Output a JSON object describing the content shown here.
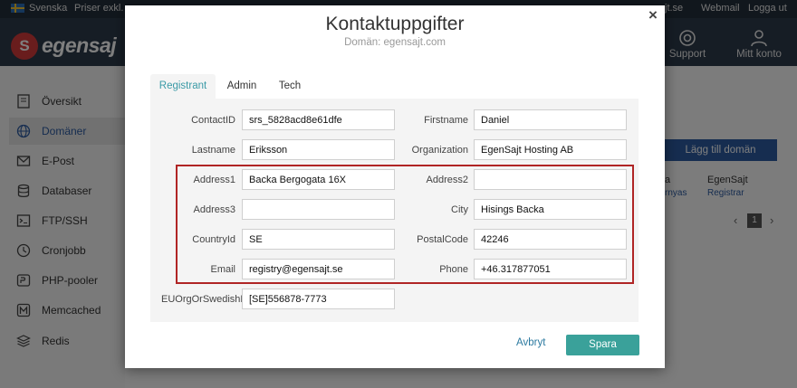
{
  "topbar": {
    "language": "Svenska",
    "prices": "Priser exkl. m",
    "site_link": "jt.se",
    "webmail": "Webmail",
    "logout": "Logga ut"
  },
  "header": {
    "logo_mark": "S",
    "logo_text": "egensaj",
    "support": "Support",
    "account": "Mitt konto"
  },
  "sidebar": {
    "items": [
      {
        "label": "Översikt",
        "icon": "overview-icon"
      },
      {
        "label": "Domäner",
        "icon": "globe-icon"
      },
      {
        "label": "E-Post",
        "icon": "email-icon"
      },
      {
        "label": "Databaser",
        "icon": "database-icon"
      },
      {
        "label": "FTP/SSH",
        "icon": "terminal-icon"
      },
      {
        "label": "Cronjobb",
        "icon": "clock-icon"
      },
      {
        "label": "PHP-pooler",
        "icon": "php-icon"
      },
      {
        "label": "Memcached",
        "icon": "memcached-icon"
      },
      {
        "label": "Redis",
        "icon": "redis-icon"
      }
    ]
  },
  "main": {
    "add_domain": "Lägg till domän",
    "col_a": "a",
    "col_a_sub": "rnyas",
    "col_b": "EgenSajt",
    "col_b_sub": "Registrar",
    "page_number": "1"
  },
  "modal": {
    "title": "Kontaktuppgifter",
    "subtitle": "Domän: egensajt.com",
    "close": "×",
    "tabs": [
      "Registrant",
      "Admin",
      "Tech"
    ],
    "fields": {
      "contact_id": {
        "label": "ContactID",
        "value": "srs_5828acd8e61dfe"
      },
      "firstname": {
        "label": "Firstname",
        "value": "Daniel"
      },
      "lastname": {
        "label": "Lastname",
        "value": "Eriksson"
      },
      "organization": {
        "label": "Organization",
        "value": "EgenSajt Hosting AB"
      },
      "address1": {
        "label": "Address1",
        "value": "Backa Bergogata 16X"
      },
      "address2": {
        "label": "Address2",
        "value": ""
      },
      "address3": {
        "label": "Address3",
        "value": ""
      },
      "city": {
        "label": "City",
        "value": "Hisings Backa"
      },
      "country_id": {
        "label": "CountryId",
        "value": "SE"
      },
      "postal_code": {
        "label": "PostalCode",
        "value": "42246"
      },
      "email": {
        "label": "Email",
        "value": "registry@egensajt.se"
      },
      "phone": {
        "label": "Phone",
        "value": "+46.317877051"
      },
      "eu_org": {
        "label": "EUOrgOrSwedishPe",
        "value": "[SE]556878-7773"
      }
    },
    "cancel": "Avbryt",
    "save": "Spara"
  },
  "colors": {
    "accent_teal": "#3aa19a",
    "tab_active_text": "#3a9aa6",
    "highlight_border": "#b02525",
    "primary_blue": "#2c5aa0"
  }
}
